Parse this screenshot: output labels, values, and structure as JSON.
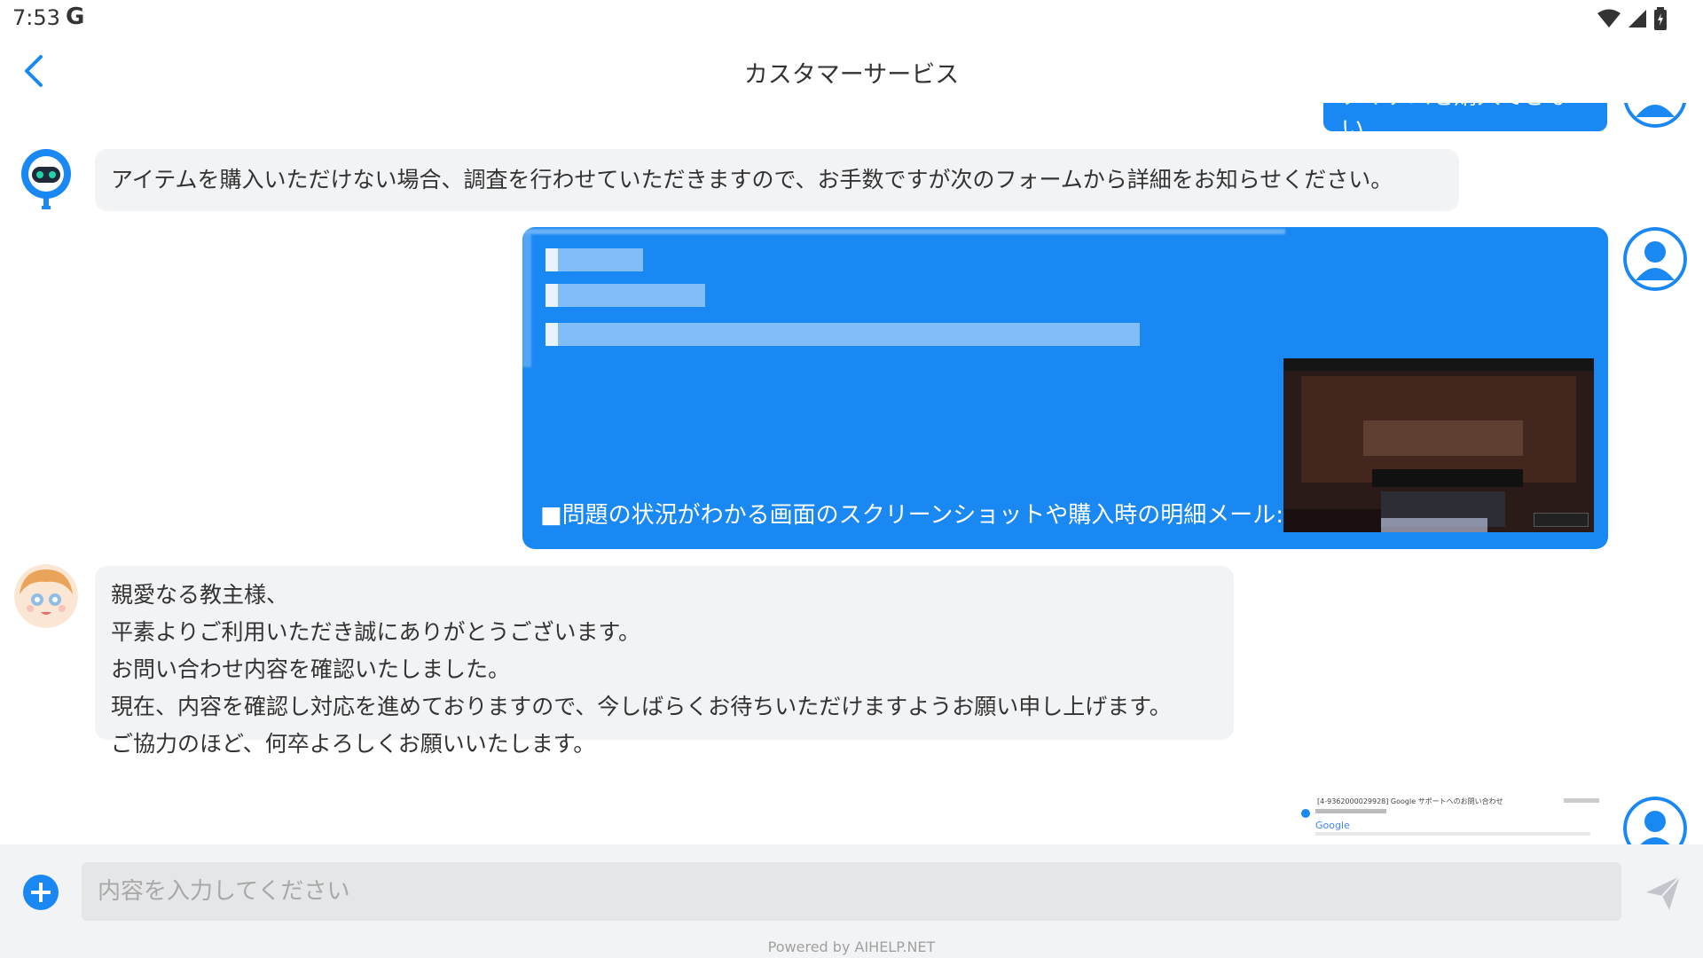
{
  "status": {
    "time": "7:53",
    "google_letter": "G"
  },
  "header": {
    "title": "カスタマーサービス"
  },
  "messages": {
    "user_top_partial": "アイテムを購入できない",
    "bot_1": "アイテムを購入いただけない場合、調査を行わせていただきますので、お手数ですが次のフォームから詳細をお知らせください。",
    "user_form_text": "■問題の状況がわかる画面のスクリーンショットや購入時の明細メール:",
    "bot_2": {
      "line1": "親愛なる教主様、",
      "line2": "平素よりご利用いただき誠にありがとうございます。",
      "line3": "お問い合わせ内容を確認いたしました。",
      "line4": "現在、内容を確認し対応を進めておりますので、今しばらくお待ちいただけますようお願い申し上げます。",
      "line5": "ご協力のほど、何卒よろしくお願いいたします。"
    },
    "mail_thumb": {
      "subject": "[4-9362000029928] Google サポートへのお問い合わせ",
      "logo": "Google"
    }
  },
  "input": {
    "placeholder": "内容を入力してください"
  },
  "footer": {
    "powered_by": "Powered by AIHELP.NET"
  },
  "colors": {
    "accent": "#1a88f2",
    "bubble_bg": "#f2f3f5"
  }
}
